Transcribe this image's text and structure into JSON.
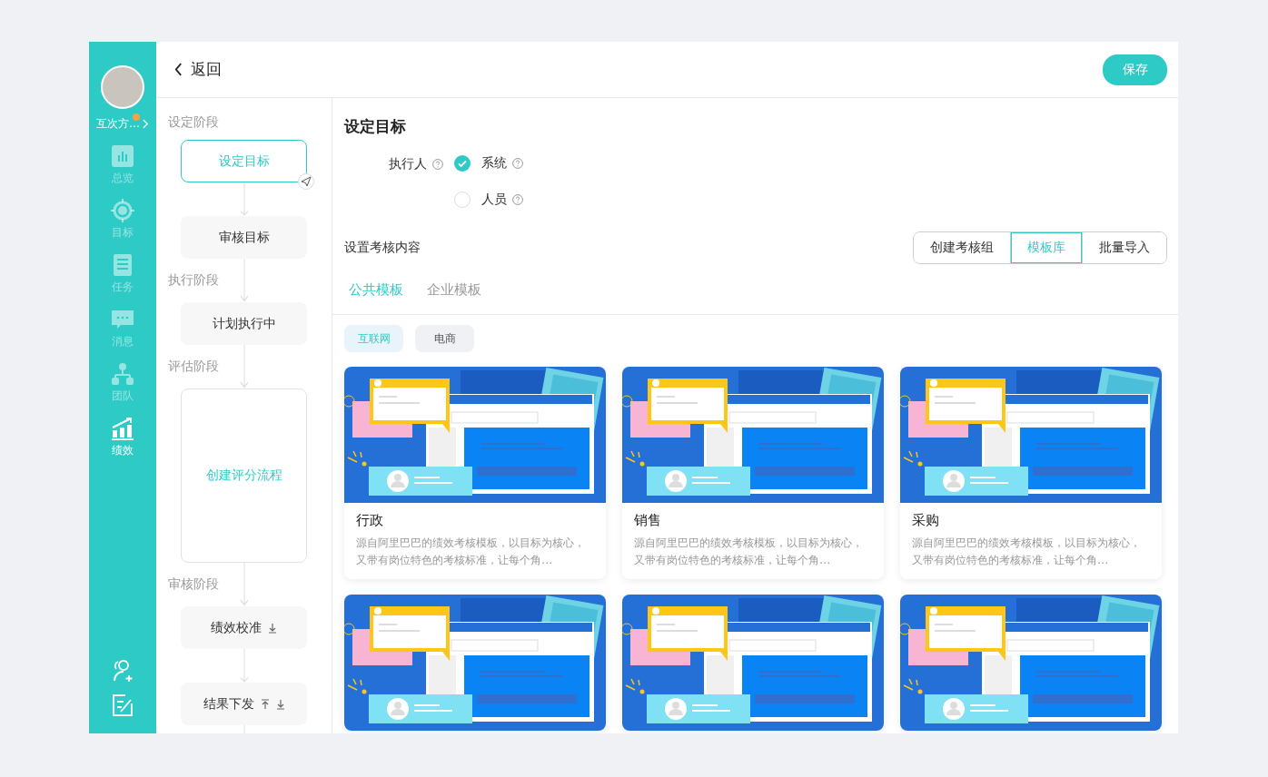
{
  "sidebar": {
    "user": {
      "name": "互次方…",
      "notification_dot": true
    },
    "items": [
      {
        "label": "总览",
        "selected": false
      },
      {
        "label": "目标",
        "selected": false
      },
      {
        "label": "任务",
        "selected": false
      },
      {
        "label": "消息",
        "selected": false
      },
      {
        "label": "团队",
        "selected": false
      },
      {
        "label": "绩效",
        "selected": true
      }
    ]
  },
  "header": {
    "back_label": "返回",
    "save_label": "保存"
  },
  "flow": [
    {
      "stage": "设定阶段",
      "nodes": [
        {
          "label": "设定目标",
          "kind": "step",
          "selected": true,
          "send_badge": true
        },
        {
          "label": "审核目标",
          "kind": "step",
          "selected": false
        }
      ]
    },
    {
      "stage": "执行阶段",
      "nodes": [
        {
          "label": "计划执行中",
          "kind": "step",
          "selected": false
        }
      ]
    },
    {
      "stage": "评估阶段",
      "nodes": [
        {
          "label": "创建评分流程",
          "kind": "block",
          "selected": false
        }
      ]
    },
    {
      "stage": "审核阶段",
      "nodes": [
        {
          "label": "绩效校准",
          "kind": "step",
          "selected": false,
          "move_down": true
        },
        {
          "label": "结果下发",
          "kind": "step",
          "selected": false,
          "move_up": true,
          "move_down": true
        }
      ]
    }
  ],
  "panel": {
    "title": "设定目标",
    "executor": {
      "label": "执行人",
      "options": [
        {
          "label": "系统",
          "selected": true
        },
        {
          "label": "人员",
          "selected": false
        }
      ]
    },
    "content_label": "设置考核内容",
    "actions": [
      {
        "label": "创建考核组",
        "selected": false
      },
      {
        "label": "模板库",
        "selected": true
      },
      {
        "label": "批量导入",
        "selected": false
      }
    ],
    "tabs": [
      {
        "label": "公共模板",
        "selected": true
      },
      {
        "label": "企业模板",
        "selected": false
      }
    ],
    "chips": [
      {
        "label": "互联网",
        "selected": true
      },
      {
        "label": "电商",
        "selected": false
      }
    ],
    "cards": [
      {
        "kind": "full",
        "title": "行政",
        "description": "源自阿里巴巴的绩效考核模板，以目标为核心，又带有岗位特色的考核标准，让每个角…"
      },
      {
        "kind": "full",
        "title": "销售",
        "description": "源自阿里巴巴的绩效考核模板，以目标为核心，又带有岗位特色的考核标准，让每个角…"
      },
      {
        "kind": "full",
        "title": "采购",
        "description": "源自阿里巴巴的绩效考核模板，以目标为核心，又带有岗位特色的考核标准，让每个角…"
      },
      {
        "kind": "image"
      },
      {
        "kind": "image"
      },
      {
        "kind": "image"
      }
    ]
  }
}
